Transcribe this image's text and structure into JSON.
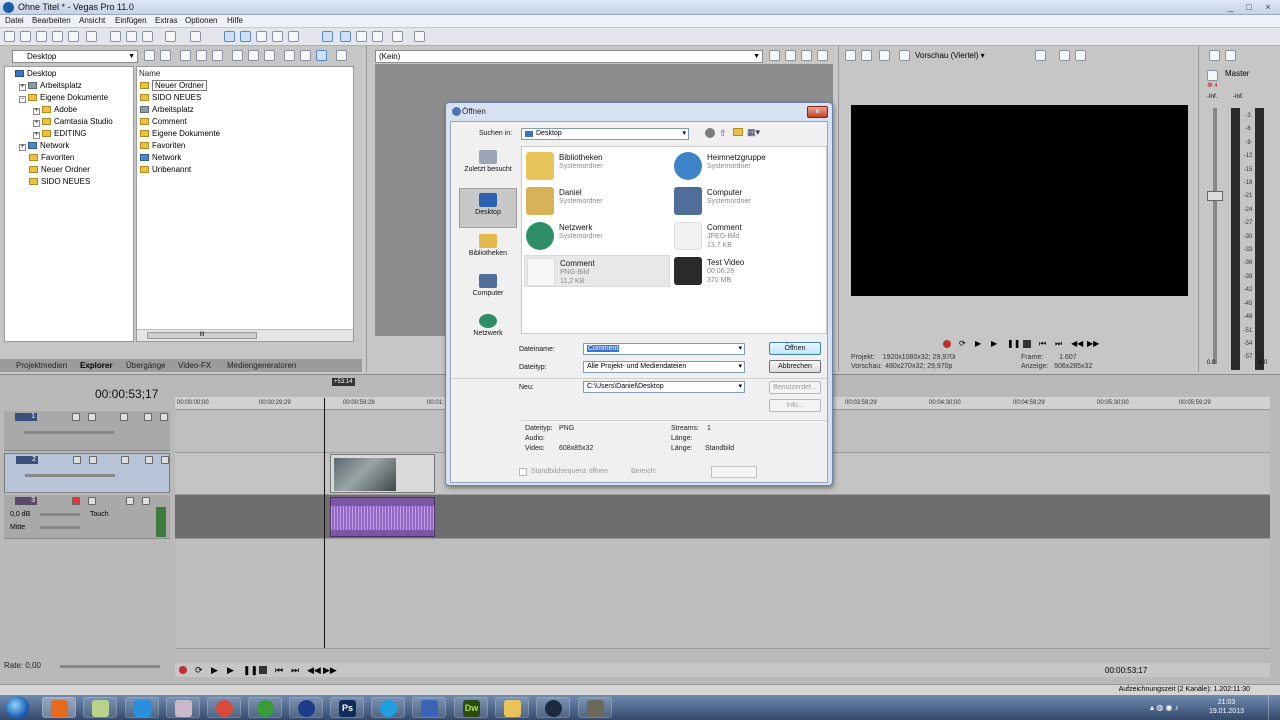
{
  "window": {
    "title": "Ohne Titel * - Vegas Pro 11.0",
    "controls": [
      "_",
      "□",
      "×"
    ]
  },
  "menu": [
    "Datei",
    "Bearbeiten",
    "Ansicht",
    "Einfügen",
    "Extras",
    "Optionen",
    "Hilfe"
  ],
  "explorer": {
    "location": "Desktop",
    "tree": [
      "Desktop",
      "Arbeitsplatz",
      "Eigene Dokumente",
      "Adobe",
      "Camtasia Studio",
      "EDITING",
      "Network",
      "Favoriten",
      "Neuer Ordner",
      "SIDO NEUES"
    ],
    "column_header": "Name",
    "files": [
      "Neuer Ordner",
      "SIDO NEUES",
      "Arbeitsplatz",
      "Comment",
      "Eigene Dokumente",
      "Favoriten",
      "Network",
      "Unbenannt"
    ],
    "scroll_label": "III",
    "tabs": [
      "Projektmedien",
      "Explorer",
      "Übergänge",
      "Video-FX",
      "Mediengeneratoren"
    ]
  },
  "trimmer": {
    "source": "(Kein)"
  },
  "preview": {
    "mode": "Vorschau (Viertel)",
    "projekt_label": "Projekt:",
    "projekt_value": "1920x1080x32; 29,970i",
    "vorschau_label": "Vorschau:",
    "vorschau_value": "480x270x32; 29,970p",
    "frame_label": "Frame:",
    "frame_value": "1.607",
    "anzeige_label": "Anzeige:",
    "anzeige_value": "506x285x32"
  },
  "master": {
    "label": "Master",
    "left_peak": "-Inf.",
    "right_peak": "-Inf.",
    "scale": [
      "3",
      "6",
      "9",
      "12",
      "15",
      "18",
      "21",
      "24",
      "27",
      "30",
      "33",
      "36",
      "39",
      "42",
      "45",
      "48",
      "51",
      "54",
      "57"
    ],
    "bottom_left": "0.0",
    "bottom_right": "0.0"
  },
  "timeline": {
    "timecode": "00:00:53;17",
    "marker": "+53:14",
    "ruler": [
      "00:00:00;00",
      "00:00:29;29",
      "00:00:59;28",
      "00:01:",
      "00:03:59;29",
      "00:04:30;00",
      "00:04:59;29",
      "00:05:30;00",
      "00:05:59;29"
    ],
    "tracks": [
      {
        "num": "1",
        "type": "video"
      },
      {
        "num": "2",
        "type": "video"
      },
      {
        "num": "3",
        "type": "audio",
        "volume": "0,0 dB",
        "mode": "Touch",
        "pan": "Mitte"
      }
    ],
    "rate": "Rate: 0,00",
    "end_time": "00:00:53;17",
    "record_status": "Aufzeichnungszeit (2 Kanäle): 1.202:11:30"
  },
  "dialog": {
    "title": "Öffnen",
    "close": "×",
    "look_in_label": "Suchen in:",
    "look_in_value": "Desktop",
    "places": [
      "Zuletzt besucht",
      "Desktop",
      "Bibliotheken",
      "Computer",
      "Netzwerk"
    ],
    "items": [
      {
        "name": "Bibliotheken",
        "type": "Systemordner",
        "size": ""
      },
      {
        "name": "Heimnetzgruppe",
        "type": "Systemordner",
        "size": ""
      },
      {
        "name": "Daniel",
        "type": "Systemordner",
        "size": ""
      },
      {
        "name": "Computer",
        "type": "Systemordner",
        "size": ""
      },
      {
        "name": "Netzwerk",
        "type": "Systemordner",
        "size": ""
      },
      {
        "name": "Comment",
        "type": "JPEG-Bild",
        "size": "13,7 KB"
      },
      {
        "name": "Comment",
        "type": "PNG-Bild",
        "size": "11,2 KB"
      },
      {
        "name": "Test Video",
        "type": "00:06:26",
        "size": "370 MB"
      }
    ],
    "filename_label": "Dateiname:",
    "filename_value": "Comment",
    "filetype_label": "Dateityp:",
    "filetype_value": "Alle Projekt- und Mediendateien",
    "recent_label": "Neu:",
    "recent_value": "C:\\Users\\Daniel\\Desktop",
    "open_button": "Öffnen",
    "cancel_button": "Abbrechen",
    "custom_button": "Benutzerdef...",
    "info_button": "Info...",
    "info": {
      "dateityp_label": "Dateityp:",
      "dateityp_value": "PNG",
      "audio_label": "Audio:",
      "audio_value": "",
      "video_label": "Video:",
      "video_value": "608x85x32",
      "streams_label": "Streams:",
      "streams_value": "1",
      "laenge_label": "Länge:",
      "laenge_value": "",
      "laenge2_label": "Länge:",
      "laenge2_value": "Standbild"
    },
    "sequence_checkbox": "Standbildsequenz öffnen",
    "range_label": "Bereich:"
  },
  "taskbar": {
    "apps": [
      "firefox",
      "folder",
      "ie",
      "tools",
      "chrome",
      "utorrent",
      "earth",
      "photoshop",
      "skype",
      "app",
      "dreamweaver",
      "explorer",
      "media",
      "game"
    ],
    "ps_label": "Ps",
    "dw_label": "Dw",
    "time": "21:03",
    "date": "19.01.2013"
  },
  "colors": {
    "accent": "#1b5ba8",
    "audio_clip": "#7e56a8",
    "preview_bg": "#000000",
    "taskbar": "#34496b"
  }
}
